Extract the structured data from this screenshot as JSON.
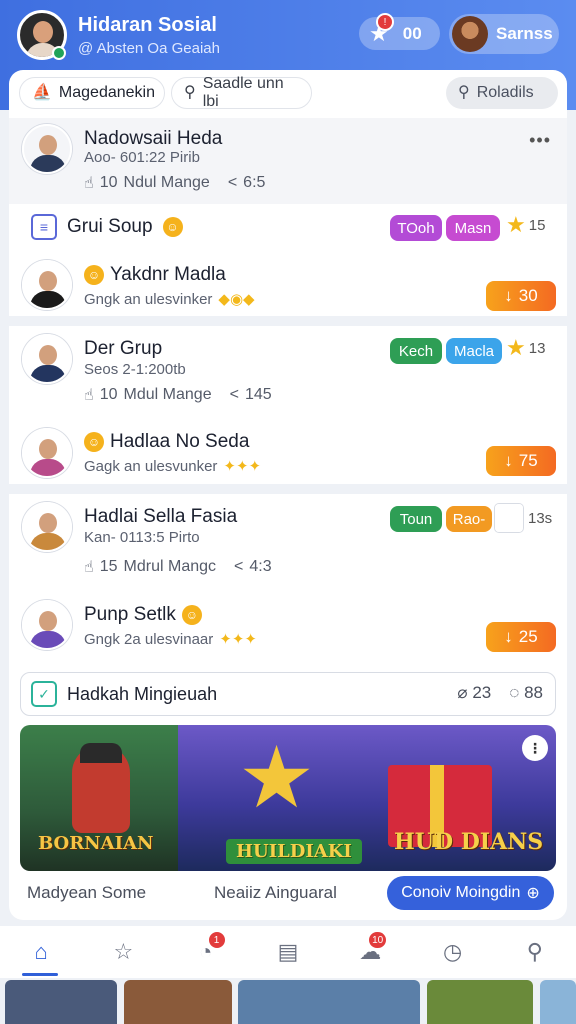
{
  "header": {
    "title": "Hidaran Sosial",
    "subtitle": "@ Absten Oa Geaiah",
    "stars_count": "00",
    "notif_badge": "!",
    "user_name": "Sarnss"
  },
  "chips": {
    "chip1": "Magedanekin",
    "chip2": "Saadle unn lbi",
    "chip3": "Roladils"
  },
  "post1": {
    "name": "Nadowsaii Heda",
    "meta": "Aoo- 601:22 Pirib",
    "likes": "10",
    "likes_label": "Ndul Mange",
    "share": "6:5"
  },
  "group1": {
    "title": "Grui Soup",
    "tag1": "TOoh",
    "tag2": "Masn",
    "count": "15",
    "sub_name": "Yakdnr Madla",
    "sub_meta": "Gngk an ulesvinker",
    "vote": "30"
  },
  "post2": {
    "name": "Der Grup",
    "meta": "Seos 2-1:200tb",
    "likes": "10",
    "likes_label": "Mdul Mange",
    "share": "145",
    "tag1": "Kech",
    "tag2": "Macla",
    "count": "13",
    "sub_name": "Hadlaa No Seda",
    "sub_meta": "Gagk an ulesvunker",
    "vote": "75"
  },
  "post3": {
    "name": "Hadlai Sella Fasia",
    "meta": "Kan- 0113:5 Pirto",
    "likes": "15",
    "likes_label": "Mdrul Mangc",
    "share": "4:3",
    "tag1": "Toun",
    "tag2": "Rao-",
    "count": "13s",
    "sub_name": "Punp Setlk",
    "sub_meta": "Gngk 2a ulesvinaar",
    "vote": "25"
  },
  "section": {
    "title": "Hadkah Mingieuah",
    "stat1": "23",
    "stat2": "88"
  },
  "banner": {
    "left_text": "BORNAIAN",
    "center_text": "HUILDIAKI",
    "right_text": "HUD DIANS"
  },
  "footer": {
    "left": "Madyean Some",
    "center": "Neaiiz Ainguaral",
    "button": "Conoiv Moingdin"
  },
  "nav": {
    "badge1": "1",
    "badge2": "10"
  },
  "colors": {
    "brand": "#3f6fe0",
    "vote": "#f46a22",
    "tag_purple": "#b34bd6",
    "tag_pink": "#c64bd1",
    "tag_green": "#2e9e55",
    "tag_blue": "#3ba4ea",
    "tag_orange": "#f29a22",
    "button": "#3561db"
  }
}
